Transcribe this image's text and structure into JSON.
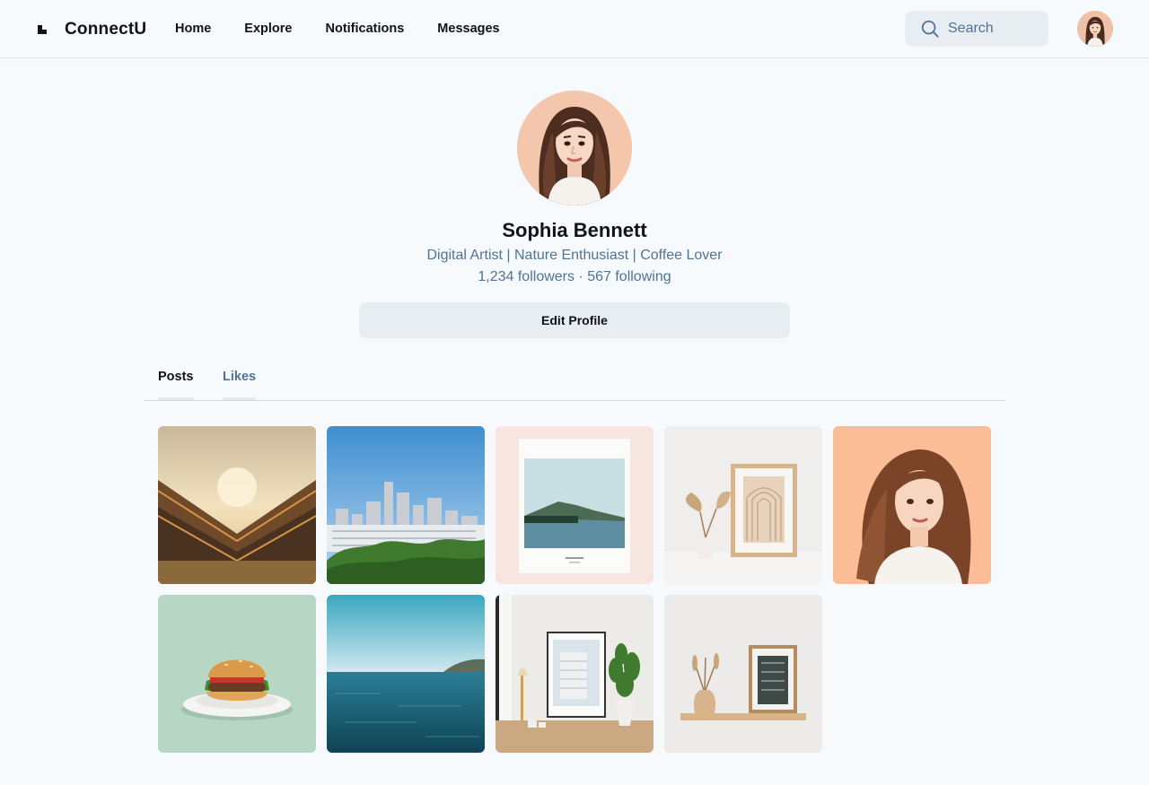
{
  "app": {
    "title": "ConnectU"
  },
  "nav": {
    "items": [
      "Home",
      "Explore",
      "Notifications",
      "Messages"
    ]
  },
  "search": {
    "placeholder": "Search"
  },
  "profile": {
    "name": "Sophia Bennett",
    "bio": "Digital Artist | Nature Enthusiast | Coffee Lover",
    "stats": "1,234 followers · 567 following",
    "edit_label": "Edit Profile"
  },
  "tabs": [
    {
      "label": "Posts",
      "active": true
    },
    {
      "label": "Likes",
      "active": false
    }
  ],
  "posts": [
    {
      "subject": "mountain-sunset"
    },
    {
      "subject": "city-skyline"
    },
    {
      "subject": "framed-lake-print"
    },
    {
      "subject": "framed-arch-art-with-vase"
    },
    {
      "subject": "woman-portrait-illustration"
    },
    {
      "subject": "burger-on-plate"
    },
    {
      "subject": "ocean-horizon"
    },
    {
      "subject": "framed-building-photo-interior"
    },
    {
      "subject": "framed-art-on-shelf"
    }
  ],
  "colors": {
    "background": "#f7fafc",
    "text_primary": "#0d141c",
    "text_secondary": "#4f7396",
    "button_bg": "#e8edf2",
    "divider": "#d1dbe6"
  }
}
